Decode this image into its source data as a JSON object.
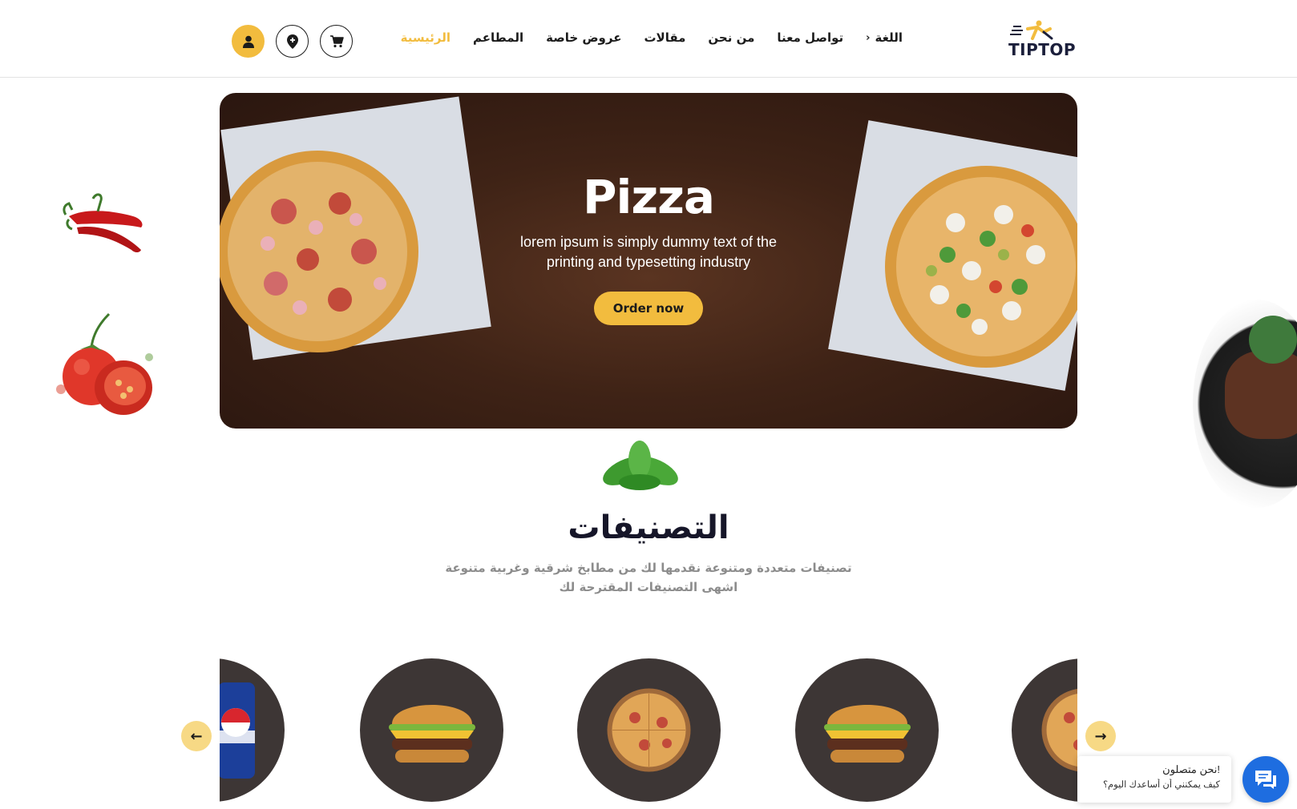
{
  "brand": {
    "logo_text": "TIPTOP",
    "accent": "#f2bc3e",
    "dark": "#161629"
  },
  "nav": {
    "items": [
      {
        "label": "الرئيسية",
        "active": true
      },
      {
        "label": "المطاعم"
      },
      {
        "label": "عروض خاصة"
      },
      {
        "label": "مقالات"
      },
      {
        "label": "من نحن"
      },
      {
        "label": "تواصل معنا"
      }
    ],
    "language_label": "اللغة"
  },
  "header_icons": [
    "cart-icon",
    "location-pin-icon",
    "user-icon"
  ],
  "hero": {
    "title": "Pizza",
    "subtitle_line1": "lorem ipsum is simply dummy text of the",
    "subtitle_line2": "printing and typesetting industry",
    "cta_label": "Order now"
  },
  "categories": {
    "title": "التصنيفات",
    "desc_line1": "تصنيفات متعددة ومتنوعة نقدمها لك من مطابخ شرقية وغربية متنوعة",
    "desc_line2": "اشهى التصنيفات المقترحة لك",
    "items": [
      "pepsi-can",
      "burger",
      "pizza",
      "burger",
      "pizza"
    ]
  },
  "chat": {
    "title": "!نحن متصلون",
    "subtitle": "كيف يمكنني أن أساعدك اليوم؟"
  }
}
